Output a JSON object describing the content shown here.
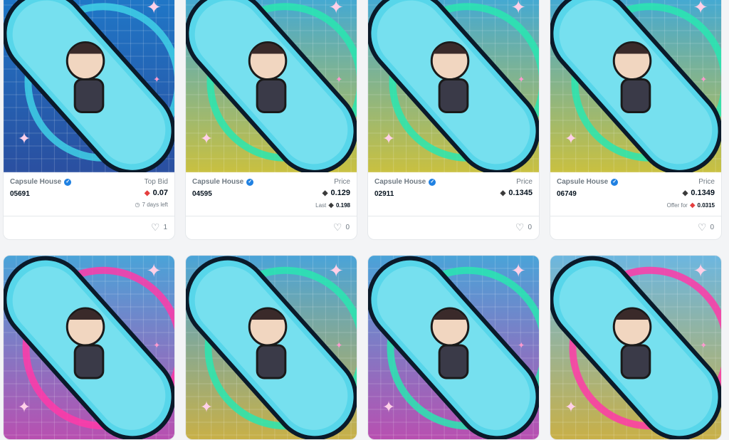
{
  "collection_name": "Capsule House",
  "verified_icon": "check-badge-icon",
  "eth_icon": "eth-diamond-icon",
  "heart_icon": "heart-outline-icon",
  "cards": [
    {
      "token": "05691",
      "price_label": "Top Bid",
      "price": "0.07",
      "sub_text": "7 days left",
      "sub_value": "",
      "favorites": "1",
      "bg": "#1f78c8",
      "ring": "#3fd0e6"
    },
    {
      "token": "04595",
      "price_label": "Price",
      "price": "0.129",
      "sub_text": "Last",
      "sub_value": "0.198",
      "favorites": "0",
      "bg": "#3fa8d8",
      "ring": "#29e6b0"
    },
    {
      "token": "02911",
      "price_label": "Price",
      "price": "0.1345",
      "sub_text": "",
      "sub_value": "",
      "favorites": "0",
      "bg": "#3fa8d8",
      "ring": "#29e6b0"
    },
    {
      "token": "06749",
      "price_label": "Price",
      "price": "0.1349",
      "sub_text": "Offer for",
      "sub_value": "0.0315",
      "favorites": "0",
      "bg": "#3fa8d8",
      "ring": "#29e6b0"
    },
    {
      "bg": "#4aa3d8",
      "ring": "#ff3aa8"
    },
    {
      "bg": "#4aa3d8",
      "ring": "#29e6b0"
    },
    {
      "bg": "#4aa3d8",
      "ring": "#29e6b0"
    },
    {
      "bg": "#6cb6e0",
      "ring": "#ff3aa8"
    }
  ]
}
